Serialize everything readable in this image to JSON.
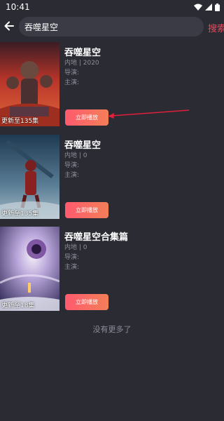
{
  "status": {
    "time": "10:41"
  },
  "search": {
    "query": "吞噬星空",
    "button_label": "搜索"
  },
  "results": [
    {
      "title": "吞噬星空",
      "region_year": "内地 | 2020",
      "director": "导演:",
      "actors": "主演:",
      "poster_caption": "更新至135集",
      "play_label": "立即播放"
    },
    {
      "title": "吞噬星空",
      "region_year": "内地 | 0",
      "director": "导演:",
      "actors": "主演:",
      "poster_caption": "更新至135集",
      "play_label": "立即播放"
    },
    {
      "title": "吞噬星空合集篇",
      "region_year": "内地 | 0",
      "director": "导演:",
      "actors": "主演:",
      "poster_caption": "更新至18集",
      "play_label": "立即播放"
    }
  ],
  "footer": {
    "no_more": "没有更多了"
  },
  "colors": {
    "background": "#2a2b33",
    "accent": "#e64a5c",
    "button_gradient": [
      "#ff5a6e",
      "#f37f58"
    ]
  },
  "icons": [
    "wifi-icon",
    "signal-icon",
    "battery-icon",
    "back-arrow-icon"
  ]
}
